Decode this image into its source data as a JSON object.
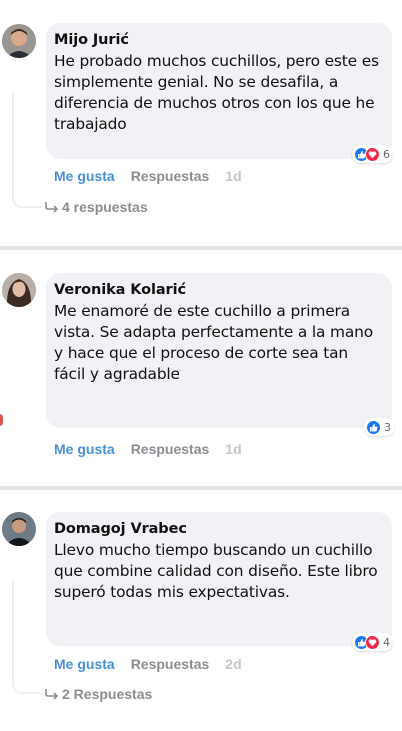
{
  "comments": [
    {
      "author": "Mijo Jurić",
      "text": "He probado muchos cuchillos, pero este es simplemente genial. No se desafila, a diferencia de muchos otros con los que he trabajado",
      "reaction_count": "6",
      "reactions": [
        "like",
        "love"
      ],
      "like_label": "Me gusta",
      "reply_label": "Respuestas",
      "time": "1d",
      "replies_text": "4 respuestas"
    },
    {
      "author": "Veronika Kolarić",
      "text": "Me enamoré de este cuchillo a primera vista. Se adapta perfectamente a la mano y hace que el proceso de corte sea tan fácil y agradable",
      "reaction_count": "3",
      "reactions": [
        "like"
      ],
      "like_label": "Me gusta",
      "reply_label": "Respuestas",
      "time": "1d"
    },
    {
      "author": "Domagoj Vrabec",
      "text": "Llevo mucho tiempo buscando un cuchillo que combine calidad con diseño. Este libro superó todas mis expectativas.",
      "reaction_count": "4",
      "reactions": [
        "like",
        "love"
      ],
      "like_label": "Me gusta",
      "reply_label": "Respuestas",
      "time": "2d",
      "replies_text": "2 Respuestas"
    }
  ],
  "colors": {
    "bubble_bg": "#f0f2f5",
    "like_blue": "#4a90d9",
    "love_red": "#f0284a",
    "divider": "#e9e5e0"
  }
}
